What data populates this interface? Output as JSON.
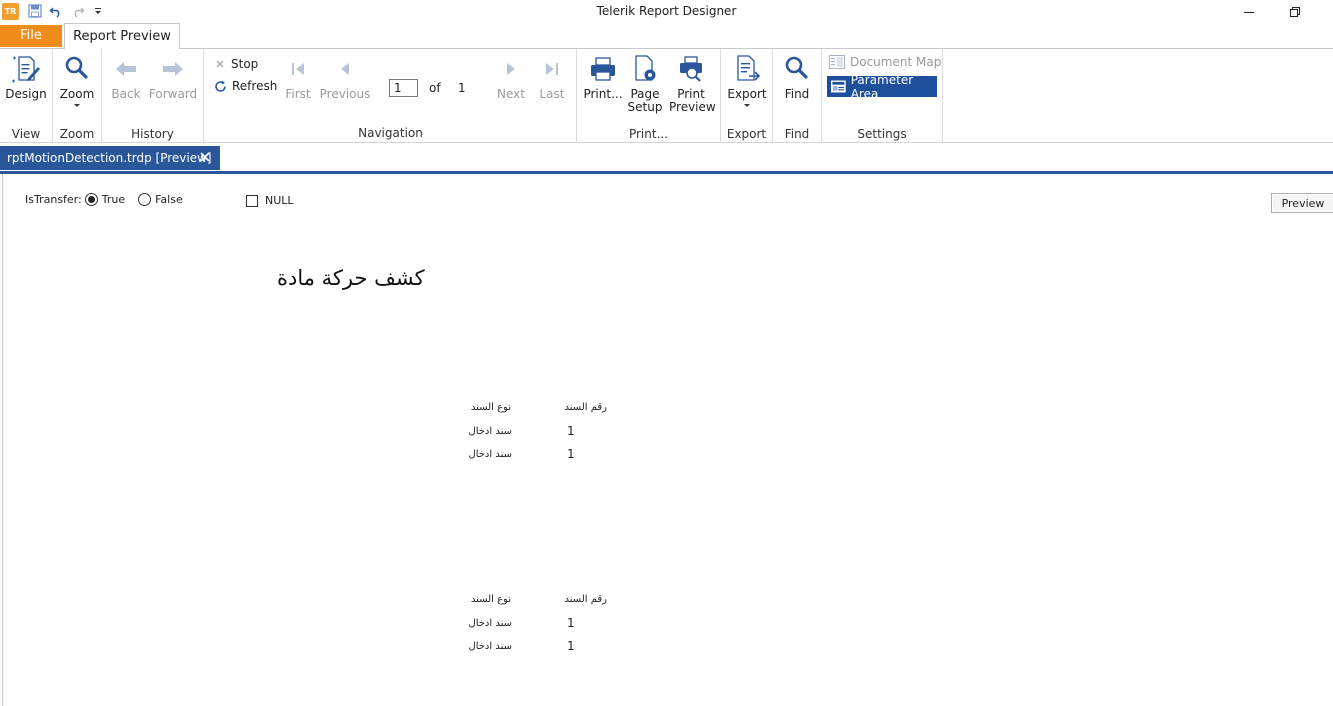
{
  "window": {
    "title": "Telerik Report Designer",
    "app_icon_text": "TR"
  },
  "ribbon_tabs": {
    "file": "File",
    "report_preview": "Report Preview"
  },
  "ribbon": {
    "view": {
      "label": "View",
      "design": "Design"
    },
    "zoom": {
      "label": "Zoom",
      "zoom": "Zoom"
    },
    "history": {
      "label": "History",
      "back": "Back",
      "forward": "Forward"
    },
    "navigation": {
      "label": "Navigation",
      "stop": "Stop",
      "refresh": "Refresh",
      "first": "First",
      "previous": "Previous",
      "page_value": "1",
      "of": "of",
      "total_pages": "1",
      "next": "Next",
      "last": "Last"
    },
    "print": {
      "label": "Print...",
      "print": "Print...",
      "page_setup": "Page Setup",
      "print_preview": "Print Preview"
    },
    "export": {
      "label": "Export",
      "export": "Export"
    },
    "find": {
      "label": "Find",
      "find": "Find"
    },
    "settings": {
      "label": "Settings",
      "document_map": "Document Map",
      "parameter_area": "Parameter Area"
    }
  },
  "document_tab": {
    "label": "rptMotionDetection.trdp [Preview]"
  },
  "parameters": {
    "istransfer_label": "IsTransfer:",
    "true_label": "True",
    "false_label": "False",
    "true_selected": true,
    "null_label": "NULL",
    "preview_button": "Preview"
  },
  "report": {
    "title": "كشف حركة مادة",
    "tables": [
      {
        "header": {
          "col1": "رقم السند",
          "col2": "نوع السند"
        },
        "rows": [
          {
            "col1": "1",
            "col2": "سند ادخال"
          },
          {
            "col1": "1",
            "col2": "سند ادخال"
          }
        ]
      },
      {
        "header": {
          "col1": "رقم السند",
          "col2": "نوع السند"
        },
        "rows": [
          {
            "col1": "1",
            "col2": "سند ادخال"
          },
          {
            "col1": "1",
            "col2": "سند ادخال"
          }
        ]
      }
    ]
  },
  "colors": {
    "file_tab": "#f08c1a",
    "document_tab": "#2a579a",
    "parameter_area_active": "#1e4f9c"
  }
}
